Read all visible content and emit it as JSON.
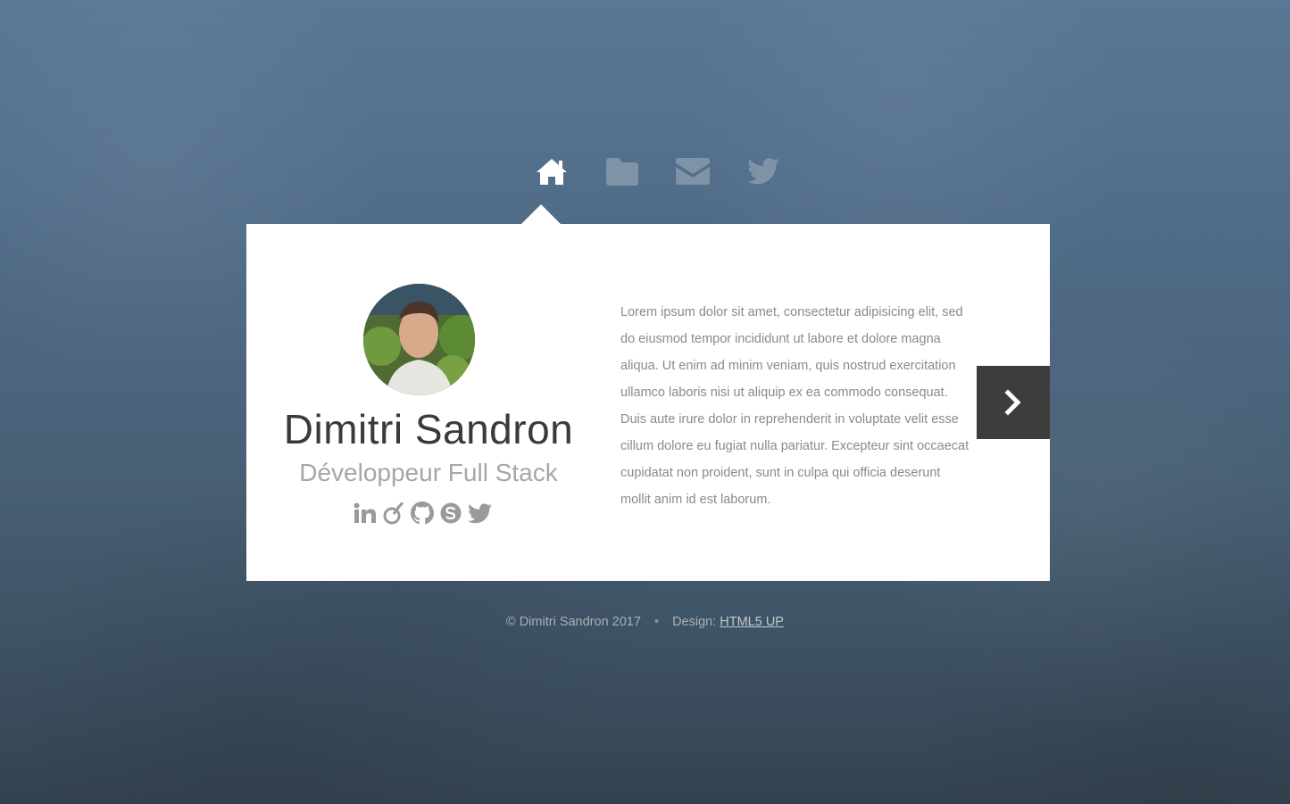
{
  "nav": {
    "items": [
      {
        "icon": "home-icon",
        "active": true
      },
      {
        "icon": "folder-icon",
        "active": false
      },
      {
        "icon": "envelope-icon",
        "active": false
      },
      {
        "icon": "twitter-icon",
        "active": false
      }
    ]
  },
  "profile": {
    "name": "Dimitri Sandron",
    "role": "Développeur Full Stack",
    "socials": [
      "linkedin-icon",
      "viadeo-icon",
      "github-icon",
      "skype-icon",
      "twitter-icon"
    ]
  },
  "bio": "Lorem ipsum dolor sit amet, consectetur adipisicing elit, sed do eiusmod tempor incididunt ut labore et dolore magna aliqua. Ut enim ad minim veniam, quis nostrud exercitation ullamco laboris nisi ut aliquip ex ea commodo consequat. Duis aute irure dolor in reprehenderit in voluptate velit esse cillum dolore eu fugiat nulla pariatur. Excepteur sint occaecat cupidatat non proident, sunt in culpa qui officia deserunt mollit anim id est laborum.",
  "footer": {
    "copyright": "© Dimitri Sandron 2017",
    "separator": "•",
    "design_label": "Design:",
    "design_link": "HTML5 UP"
  },
  "colors": {
    "nav_active": "#ffffff",
    "nav_inactive": "#7e93a6",
    "next_button_bg": "#3d3d3d",
    "name_text": "#3a3a3a",
    "muted_text": "#a6a6a6"
  }
}
